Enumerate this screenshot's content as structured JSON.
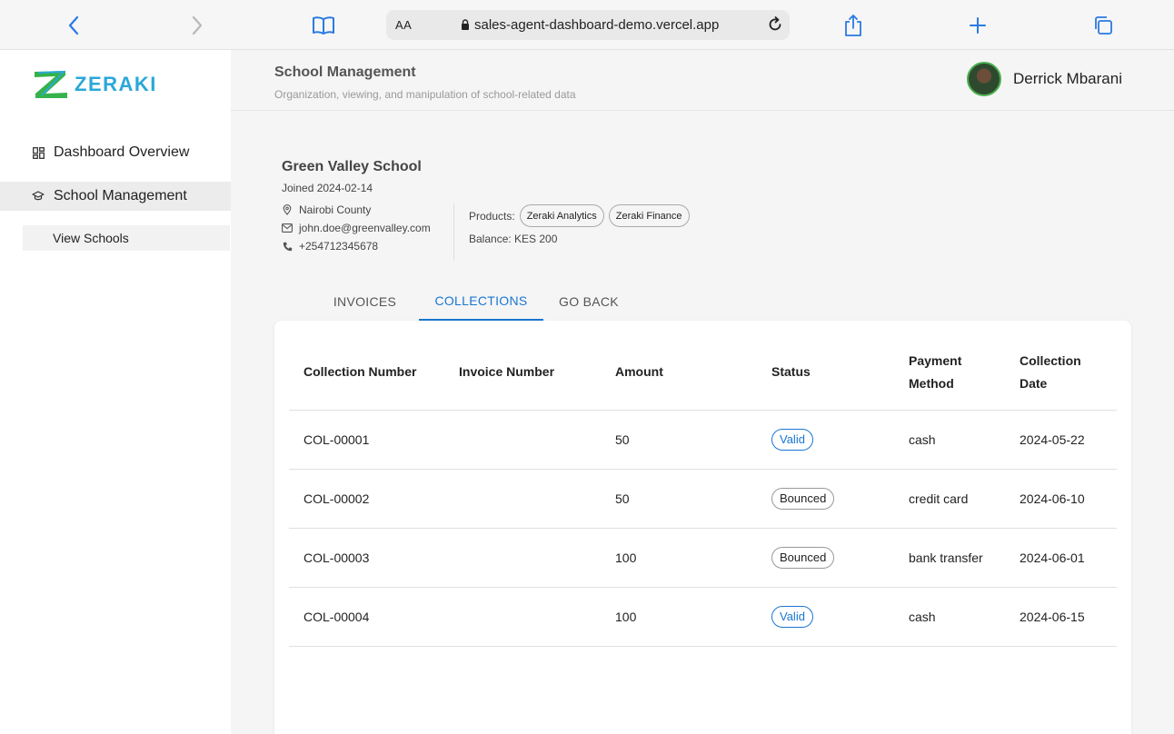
{
  "browser": {
    "aa_label": "AA",
    "url": "sales-agent-dashboard-demo.vercel.app"
  },
  "sidebar": {
    "logo_text": "ZERAKI",
    "items": [
      {
        "label": "Dashboard Overview",
        "icon": "dashboard-icon"
      },
      {
        "label": "School Management",
        "icon": "graduation-cap-icon"
      }
    ],
    "sub_items": [
      {
        "label": "View Schools"
      }
    ]
  },
  "header": {
    "title": "School Management",
    "subtitle": "Organization, viewing, and manipulation of school-related data",
    "user_name": "Derrick Mbarani"
  },
  "school": {
    "name": "Green Valley School",
    "joined": "Joined 2024-02-14",
    "county": "Nairobi County",
    "email": "john.doe@greenvalley.com",
    "phone": "+254712345678",
    "products_label": "Products:",
    "products": [
      "Zeraki Analytics",
      "Zeraki Finance"
    ],
    "balance": "Balance: KES 200"
  },
  "tabs": [
    {
      "label": "INVOICES"
    },
    {
      "label": "COLLECTIONS"
    },
    {
      "label": "GO BACK"
    }
  ],
  "table": {
    "headers": [
      "Collection Number",
      "Invoice Number",
      "Amount",
      "Status",
      "Payment Method",
      "Collection Date"
    ],
    "rows": [
      {
        "collection": "COL-00001",
        "invoice": "",
        "amount": "50",
        "status": "Valid",
        "method": "cash",
        "date": "2024-05-22"
      },
      {
        "collection": "COL-00002",
        "invoice": "",
        "amount": "50",
        "status": "Bounced",
        "method": "credit card",
        "date": "2024-06-10"
      },
      {
        "collection": "COL-00003",
        "invoice": "",
        "amount": "100",
        "status": "Bounced",
        "method": "bank transfer",
        "date": "2024-06-01"
      },
      {
        "collection": "COL-00004",
        "invoice": "",
        "amount": "100",
        "status": "Valid",
        "method": "cash",
        "date": "2024-06-15"
      }
    ]
  },
  "colors": {
    "accent": "#1976d2",
    "logo": "#2aa8d8",
    "avatar_ring": "#4caf50"
  }
}
